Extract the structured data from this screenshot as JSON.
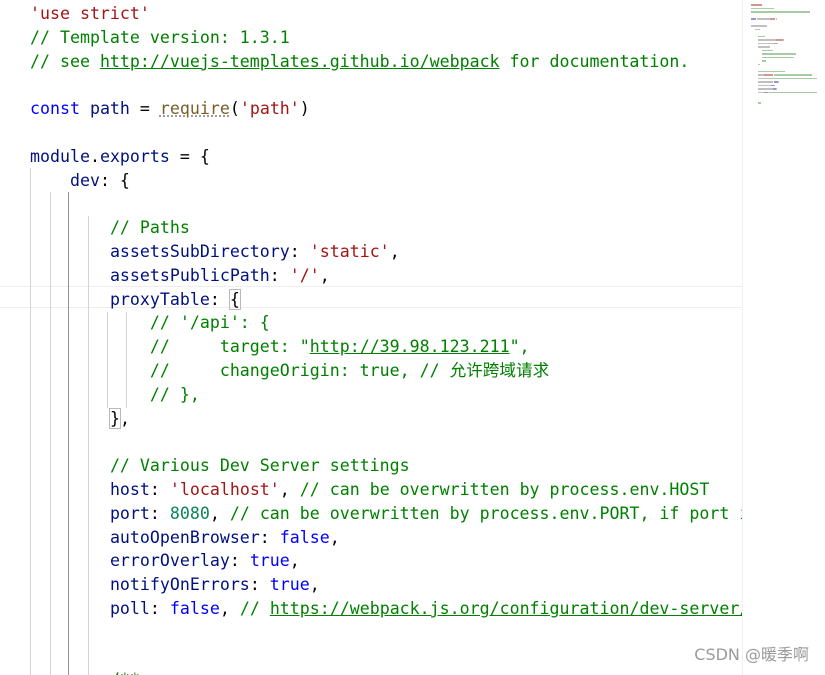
{
  "editor": {
    "lines": [
      [
        {
          "t": "'use strict'",
          "c": "str"
        }
      ],
      [
        {
          "t": "// Template version: 1.3.1",
          "c": "cmt"
        }
      ],
      [
        {
          "t": "// see ",
          "c": "cmt"
        },
        {
          "t": "http://vuejs-templates.github.io/webpack",
          "c": "link"
        },
        {
          "t": " for documentation.",
          "c": "cmt"
        }
      ],
      [],
      [
        {
          "t": "const",
          "c": "kw"
        },
        {
          "t": " ",
          "c": "pun"
        },
        {
          "t": "path",
          "c": "prop"
        },
        {
          "t": " = ",
          "c": "pun"
        },
        {
          "t": "require",
          "c": "fn dots"
        },
        {
          "t": "(",
          "c": "pun"
        },
        {
          "t": "'path'",
          "c": "str"
        },
        {
          "t": ")",
          "c": "pun"
        }
      ],
      [],
      [
        {
          "t": "module",
          "c": "prop"
        },
        {
          "t": ".",
          "c": "pun"
        },
        {
          "t": "exports",
          "c": "prop"
        },
        {
          "t": " = {",
          "c": "pun"
        }
      ],
      [
        {
          "t": "    ",
          "c": "pun"
        },
        {
          "t": "dev",
          "c": "prop"
        },
        {
          "t": ": {",
          "c": "pun"
        }
      ],
      [],
      [
        {
          "t": "        ",
          "c": "pun"
        },
        {
          "t": "// Paths",
          "c": "cmt"
        }
      ],
      [
        {
          "t": "        ",
          "c": "pun"
        },
        {
          "t": "assetsSubDirectory",
          "c": "prop"
        },
        {
          "t": ": ",
          "c": "pun"
        },
        {
          "t": "'static'",
          "c": "str"
        },
        {
          "t": ",",
          "c": "pun"
        }
      ],
      [
        {
          "t": "        ",
          "c": "pun"
        },
        {
          "t": "assetsPublicPath",
          "c": "prop"
        },
        {
          "t": ": ",
          "c": "pun"
        },
        {
          "t": "'/'",
          "c": "str"
        },
        {
          "t": ",",
          "c": "pun"
        }
      ],
      [
        {
          "t": "        ",
          "c": "pun"
        },
        {
          "t": "proxyTable",
          "c": "prop"
        },
        {
          "t": ": ",
          "c": "pun"
        },
        {
          "t": "{",
          "c": "pun bracket-box"
        }
      ],
      [
        {
          "t": "            ",
          "c": "pun"
        },
        {
          "t": "// '/api': {",
          "c": "cmt"
        }
      ],
      [
        {
          "t": "            ",
          "c": "pun"
        },
        {
          "t": "//     target: \"",
          "c": "cmt"
        },
        {
          "t": "http://39.98.123.211",
          "c": "link"
        },
        {
          "t": "\",",
          "c": "cmt"
        }
      ],
      [
        {
          "t": "            ",
          "c": "pun"
        },
        {
          "t": "//     changeOrigin: true, // 允许跨域请求",
          "c": "cmt"
        }
      ],
      [
        {
          "t": "            ",
          "c": "pun"
        },
        {
          "t": "// },",
          "c": "cmt"
        }
      ],
      [
        {
          "t": "        ",
          "c": "pun"
        },
        {
          "t": "}",
          "c": "pun bracket-box"
        },
        {
          "t": ",",
          "c": "pun"
        }
      ],
      [],
      [
        {
          "t": "        ",
          "c": "pun"
        },
        {
          "t": "// Various Dev Server settings",
          "c": "cmt"
        }
      ],
      [
        {
          "t": "        ",
          "c": "pun"
        },
        {
          "t": "host",
          "c": "prop"
        },
        {
          "t": ": ",
          "c": "pun"
        },
        {
          "t": "'localhost'",
          "c": "str"
        },
        {
          "t": ", ",
          "c": "pun"
        },
        {
          "t": "// can be overwritten by process.env.HOST",
          "c": "cmt"
        }
      ],
      [
        {
          "t": "        ",
          "c": "pun"
        },
        {
          "t": "port",
          "c": "prop"
        },
        {
          "t": ": ",
          "c": "pun"
        },
        {
          "t": "8080",
          "c": "num"
        },
        {
          "t": ", ",
          "c": "pun"
        },
        {
          "t": "// can be overwritten by process.env.PORT, if port is",
          "c": "cmt"
        }
      ],
      [
        {
          "t": "        ",
          "c": "pun"
        },
        {
          "t": "autoOpenBrowser",
          "c": "prop"
        },
        {
          "t": ": ",
          "c": "pun"
        },
        {
          "t": "false",
          "c": "kw"
        },
        {
          "t": ",",
          "c": "pun"
        }
      ],
      [
        {
          "t": "        ",
          "c": "pun"
        },
        {
          "t": "errorOverlay",
          "c": "prop"
        },
        {
          "t": ": ",
          "c": "pun"
        },
        {
          "t": "true",
          "c": "kw"
        },
        {
          "t": ",",
          "c": "pun"
        }
      ],
      [
        {
          "t": "        ",
          "c": "pun"
        },
        {
          "t": "notifyOnErrors",
          "c": "prop"
        },
        {
          "t": ": ",
          "c": "pun"
        },
        {
          "t": "true",
          "c": "kw"
        },
        {
          "t": ",",
          "c": "pun"
        }
      ],
      [
        {
          "t": "        ",
          "c": "pun"
        },
        {
          "t": "poll",
          "c": "prop"
        },
        {
          "t": ": ",
          "c": "pun"
        },
        {
          "t": "false",
          "c": "kw"
        },
        {
          "t": ", ",
          "c": "pun"
        },
        {
          "t": "// ",
          "c": "cmt"
        },
        {
          "t": "https://webpack.js.org/configuration/dev-server/#de",
          "c": "link"
        }
      ],
      [],
      [],
      [
        {
          "t": "        ",
          "c": "pun"
        },
        {
          "t": "/**",
          "c": "cmt"
        }
      ]
    ]
  },
  "colors": {
    "comment": "#008000",
    "string": "#a31515",
    "keyword": "#0000ff",
    "property": "#001080",
    "function": "#795e26",
    "number": "#098658"
  },
  "watermark": "CSDN @暖季啊"
}
